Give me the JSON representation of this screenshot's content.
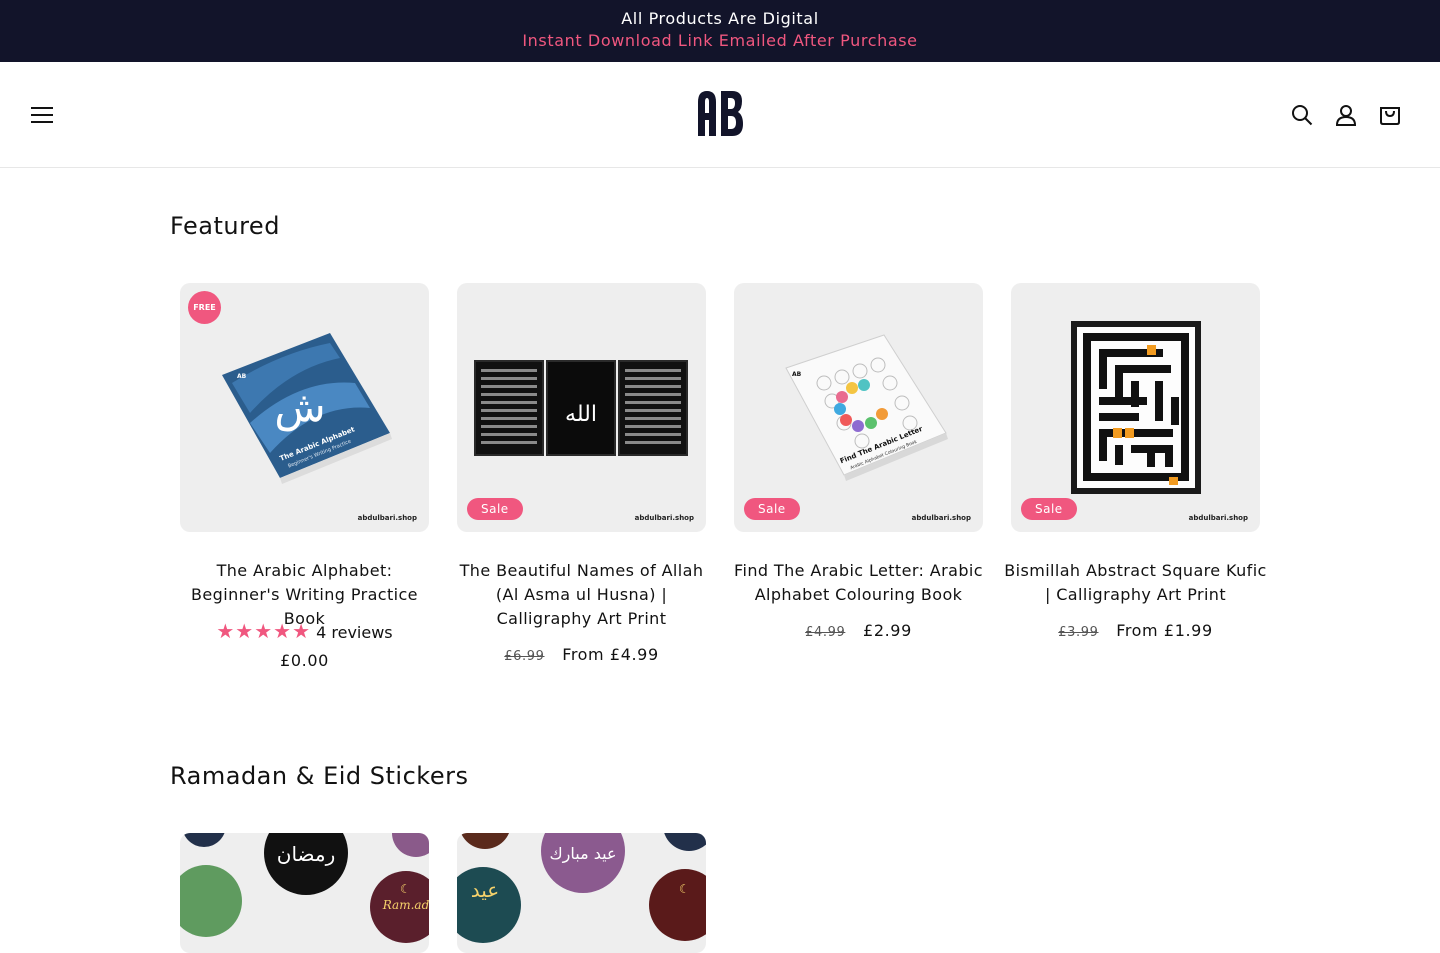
{
  "announcement": {
    "line1": "All Products Are Digital",
    "line2": "Instant Download Link Emailed After Purchase"
  },
  "header": {
    "logo_text": "AB",
    "icons": [
      "menu-icon",
      "search-icon",
      "account-icon",
      "cart-icon"
    ]
  },
  "colors": {
    "announcement_bg": "#12142a",
    "accent": "#f0577f"
  },
  "featured": {
    "title": "Featured",
    "products": [
      {
        "badge": "FREE",
        "title": "The Arabic Alphabet: Beginner's Writing Practice Book",
        "book_title": "The Arabic Alphabet",
        "book_subtitle": "Beginner's Writing Practice",
        "book_brand": "AB",
        "book_glyph": "ش",
        "rating": 5,
        "reviews": "4 reviews",
        "price": "£0.00",
        "watermark": "abdulbari.shop"
      },
      {
        "badge": "Sale",
        "title": "The Beautiful Names of Allah (Al Asma ul Husna) | Calligraphy Art Print",
        "art_glyph": "الله",
        "old_price": "£6.99",
        "price": "From £4.99",
        "watermark": "abdulbari.shop"
      },
      {
        "badge": "Sale",
        "title": "Find The Arabic Letter: Arabic Alphabet Colouring Book",
        "book_title": "Find The Arabic Letter",
        "book_subtitle": "Arabic Alphabet Colouring Book",
        "book_brand": "AB",
        "old_price": "£4.99",
        "price": "£2.99",
        "watermark": "abdulbari.shop"
      },
      {
        "badge": "Sale",
        "title": "Bismillah Abstract Square Kufic | Calligraphy Art Print",
        "old_price": "£3.99",
        "price": "From £1.99",
        "watermark": "abdulbari.shop"
      }
    ]
  },
  "stickers": {
    "title": "Ramadan & Eid Stickers",
    "sticker1_glyph": "رمضان",
    "sticker1_text": "Ram.ad",
    "sticker2_glyph": "عيد مبارك",
    "sticker2_text": "عيد"
  }
}
